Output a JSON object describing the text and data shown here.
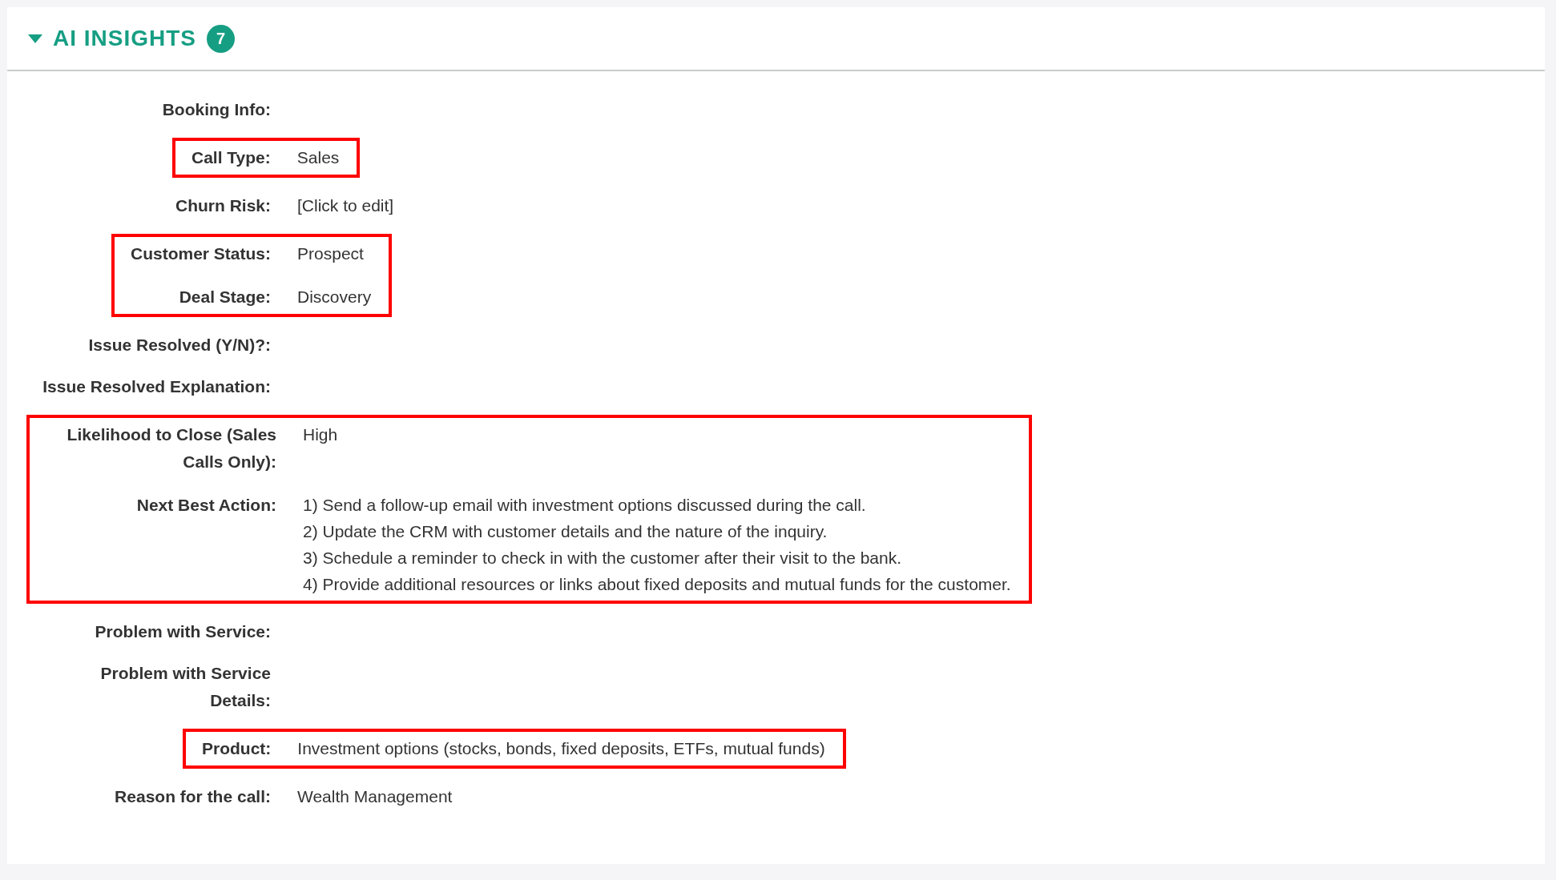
{
  "panel": {
    "title": "AI INSIGHTS",
    "count": "7",
    "expanded": true
  },
  "items": [
    {
      "kind": "row",
      "label": "Booking Info:"
    },
    {
      "kind": "highlight",
      "rows": [
        {
          "label": "Call Type:",
          "value": "Sales"
        }
      ]
    },
    {
      "kind": "row",
      "label": "Churn Risk:",
      "value": "[Click to edit]"
    },
    {
      "kind": "highlight",
      "rows": [
        {
          "label": "Customer Status:",
          "value": "Prospect"
        },
        {
          "label": "Deal Stage:",
          "value": "Discovery"
        }
      ]
    },
    {
      "kind": "row",
      "label": "Issue Resolved (Y/N)?:"
    },
    {
      "kind": "row",
      "label": "Issue Resolved Explanation:"
    },
    {
      "kind": "highlight",
      "rows": [
        {
          "label": "Likelihood to Close (Sales Calls Only):",
          "value": "High"
        },
        {
          "label": "Next Best Action:",
          "lines": [
            "1) Send a follow-up email with investment options discussed during the call.",
            "2) Update the CRM with customer details and the nature of the inquiry.",
            "3) Schedule a reminder to check in with the customer after their visit to the bank.",
            "4) Provide additional resources or links about fixed deposits and mutual funds for the customer."
          ]
        }
      ]
    },
    {
      "kind": "row",
      "label": "Problem with Service:"
    },
    {
      "kind": "row",
      "label": "Problem with Service Details:"
    },
    {
      "kind": "highlight",
      "rows": [
        {
          "label": "Product:",
          "value": "Investment options (stocks, bonds, fixed deposits, ETFs, mutual funds)"
        }
      ]
    },
    {
      "kind": "row",
      "label": "Reason for the call:",
      "value": "Wealth Management"
    }
  ]
}
